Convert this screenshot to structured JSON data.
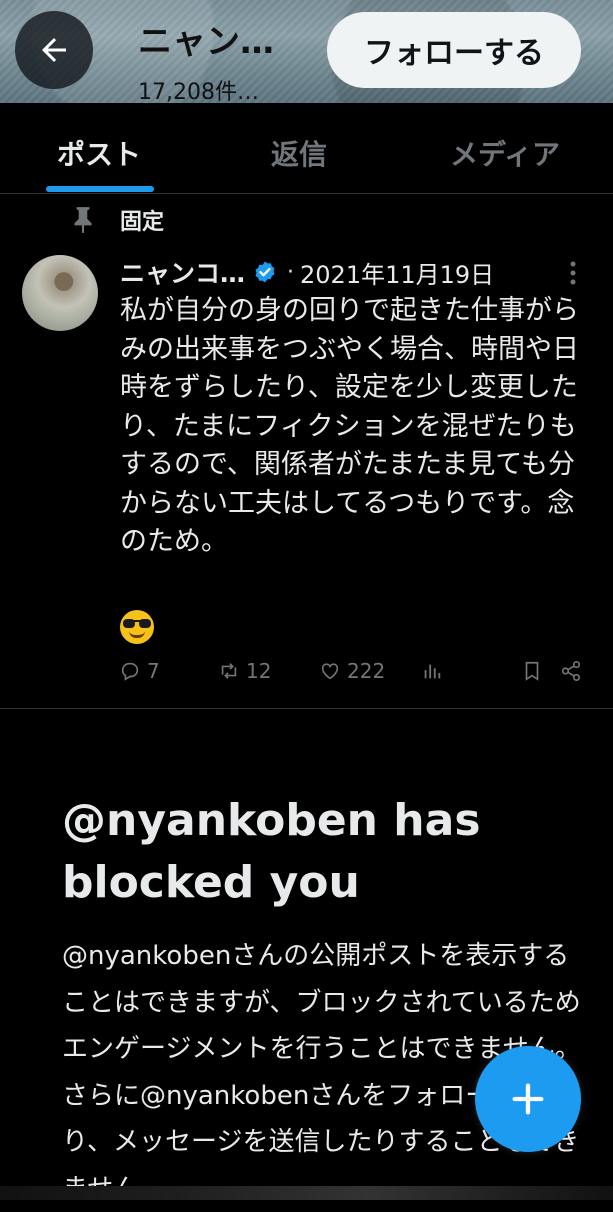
{
  "header": {
    "title": "ニャン…",
    "subtitle": "17,208件…",
    "follow_label": "フォローする",
    "back_icon": "arrow-left-icon"
  },
  "tabs": [
    {
      "label": "ポスト",
      "active": true
    },
    {
      "label": "返信",
      "active": false
    },
    {
      "label": "メディア",
      "active": false
    }
  ],
  "pinned": {
    "label": "固定",
    "icon": "pin-icon"
  },
  "post": {
    "author": "ニャンコ…",
    "verified": true,
    "separator": "·",
    "date": "2021年11月19日",
    "text": "私が自分の身の回りで起きた仕事がらみの出来事をつぶやく場合、時間や日時をずらしたり、設定を少し変更したり、たまにフィクションを混ぜたりもするので、関係者がたまたま見ても分からない工夫はしてるつもりです。念のため。",
    "emoji": "smiling-face-with-sunglasses",
    "replies": "7",
    "reposts": "12",
    "likes": "222"
  },
  "blocked": {
    "title": "@nyankoben has blocked you",
    "body": "@nyankobenさんの公開ポストを表示することはできますが、ブロックされているためエンゲージメントを行うことはできません。さらに@nyankobenさんをフォローしたり、メッセージを送信したりすることもできません。"
  },
  "fab": {
    "icon": "plus-icon"
  },
  "colors": {
    "accent": "#1d9bf0",
    "background": "#000000",
    "text": "#e7e9ea",
    "muted": "#71767b",
    "divider": "#2f3336"
  }
}
